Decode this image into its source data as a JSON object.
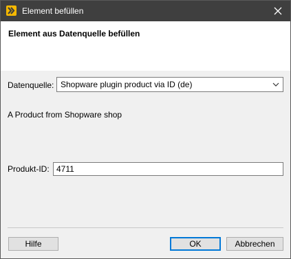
{
  "window": {
    "title": "Element befüllen",
    "app_icon": "app-logo-icon",
    "close_icon": "close-icon"
  },
  "header": {
    "title": "Element aus Datenquelle befüllen"
  },
  "form": {
    "datasource_label": "Datenquelle:",
    "datasource_value": "Shopware plugin product via ID (de)",
    "datasource_description": "A Product from Shopware shop",
    "product_id_label": "Produkt-ID:",
    "product_id_value": "4711"
  },
  "buttons": {
    "help": "Hilfe",
    "ok": "OK",
    "cancel": "Abbrechen"
  },
  "colors": {
    "titlebar": "#3f3f3f",
    "app_icon": "#f5b800",
    "default_button_border": "#0078d7"
  }
}
